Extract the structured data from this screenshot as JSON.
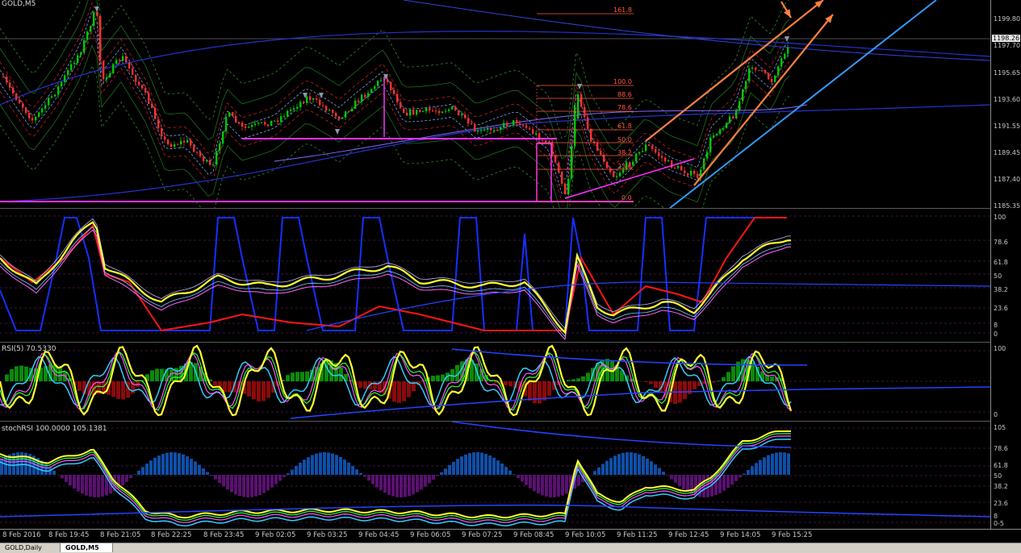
{
  "chart_title": "GOLD,M5",
  "price_axis": [
    "1199.80",
    "1197.70",
    "1195.65",
    "1193.60",
    "1191.55",
    "1189.45",
    "1187.40",
    "1185.35"
  ],
  "current_price": "1198.26",
  "fib_levels": [
    "161.8",
    "100.0",
    "88.6",
    "78.6",
    "61.8",
    "50.0",
    "38.2",
    "23.6",
    "0.0"
  ],
  "osc1_axis": [
    "100",
    "78.6",
    "61.8",
    "50",
    "38.2",
    "23.6",
    "8",
    "0"
  ],
  "rsi_title": "RSI(5) 70.5330",
  "rsi_axis": [
    "100",
    "0"
  ],
  "stoch_title": "stochRSI 100.0000 105.1381",
  "stoch_axis": [
    "105",
    "78.6",
    "61.8",
    "50",
    "38.2",
    "23.6",
    "8",
    "0"
  ],
  "stoch_axis_extra": "-5",
  "time_labels": [
    "8 Feb 2016",
    "8 Feb 19:45",
    "8 Feb 21:05",
    "8 Feb 22:25",
    "8 Feb 23:45",
    "9 Feb 02:05",
    "9 Feb 03:25",
    "9 Feb 04:45",
    "9 Feb 06:05",
    "9 Feb 07:25",
    "9 Feb 08:45",
    "9 Feb 10:05",
    "9 Feb 11:25",
    "9 Feb 12:45",
    "9 Feb 14:05",
    "9 Feb 15:25"
  ],
  "tabs": [
    "GOLD,Daily",
    "GOLD,M5"
  ],
  "colors": {
    "up": "#00c800",
    "down": "#ff3030",
    "fib": "#ff5a40",
    "support": "#ff30ff",
    "channel": "#3399ff",
    "arrow": "#ff8040",
    "rsi": "#ffff30"
  }
}
